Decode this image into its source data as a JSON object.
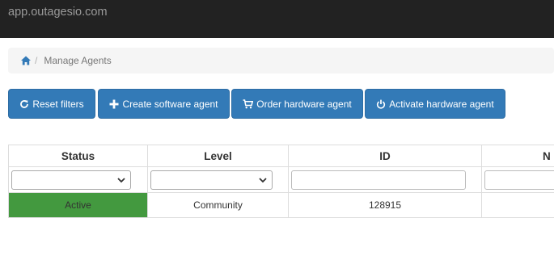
{
  "browser": {
    "url": "app.outagesio.com"
  },
  "breadcrumb": {
    "home_icon": "home-icon",
    "separator": "/",
    "current": "Manage Agents"
  },
  "toolbar": {
    "buttons": [
      {
        "icon": "refresh-icon",
        "label": "Reset filters"
      },
      {
        "icon": "plus-icon",
        "label": "Create software agent"
      },
      {
        "icon": "cart-icon",
        "label": "Order hardware agent"
      },
      {
        "icon": "power-icon",
        "label": "Activate hardware agent"
      }
    ]
  },
  "colors": {
    "primary_button": "#337ab7",
    "active_status": "#43993f",
    "topbar": "#222222"
  },
  "table": {
    "columns": [
      "Status",
      "Level",
      "ID",
      "N"
    ],
    "filters": {
      "status": "",
      "level": "",
      "id": "",
      "name": ""
    },
    "rows": [
      {
        "status": "Active",
        "level": "Community",
        "id": "128915",
        "name": ""
      }
    ]
  }
}
